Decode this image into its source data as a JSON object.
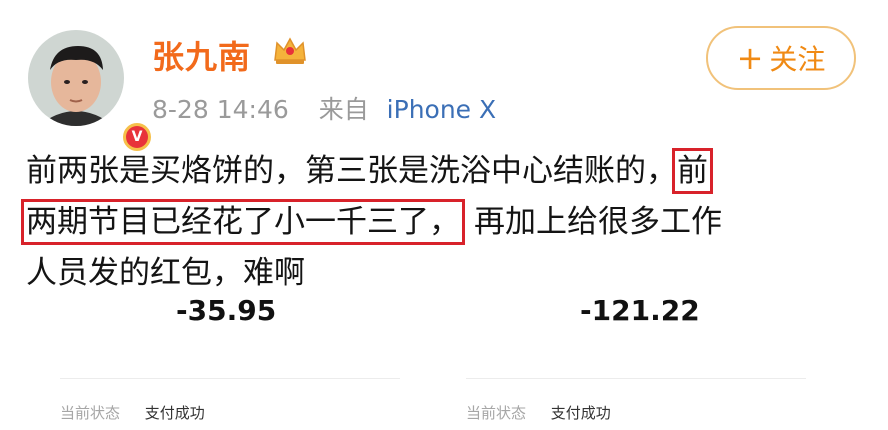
{
  "user": {
    "name": "张九南",
    "verified_mark": "V",
    "date": "8-28",
    "time": "14:46",
    "from_label": "来自",
    "source": "iPhone X"
  },
  "follow": {
    "plus": "+",
    "label": "关注"
  },
  "post": {
    "line1_a": "前两张是买烙饼的，第三张是洗浴中心结账的，",
    "line1_hl": "前",
    "line2_hl": "两期节目已经花了小一千三了，",
    "line2_b": "再加上给很多工作",
    "line3": "人员发的红包，难啊"
  },
  "receipts": [
    {
      "amount": "-35.95",
      "status_label": "当前状态",
      "status_value": "支付成功"
    },
    {
      "amount": "-121.22",
      "status_label": "当前状态",
      "status_value": "支付成功"
    }
  ],
  "colors": {
    "name": "#f26a1b",
    "source": "#3b6fb6",
    "highlight_border": "#d8222a",
    "follow_text": "#f08a14",
    "follow_border": "#f1c27a"
  },
  "icons": [
    "avatar",
    "verified-badge-icon",
    "crown-icon",
    "plus-icon"
  ]
}
